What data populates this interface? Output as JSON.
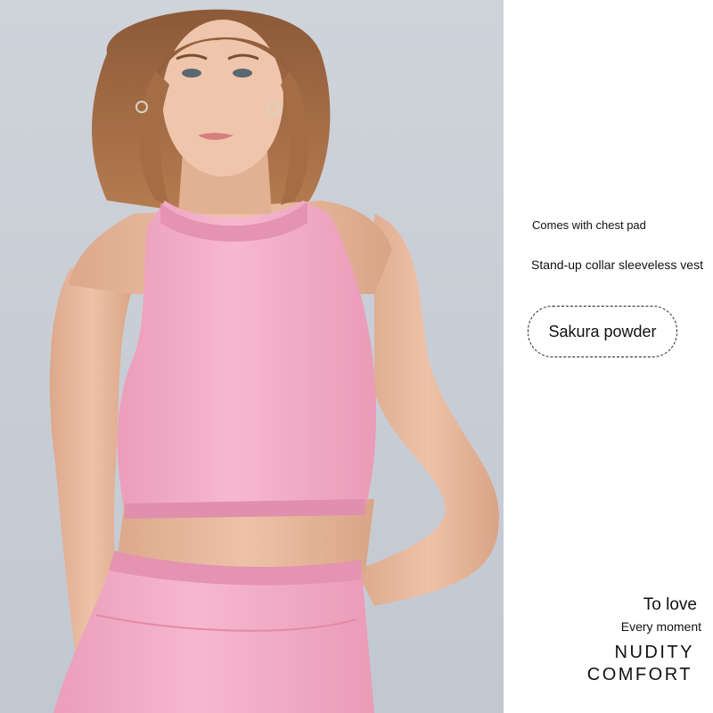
{
  "photo": {
    "subject": "woman-in-pink-crop-top",
    "colors": {
      "background": "#c9ced6",
      "garment": "#f2aac4",
      "skin": "#e8b89c",
      "hair": "#a06a45"
    }
  },
  "features": {
    "chest_pad": "Comes with chest pad",
    "collar": "Stand-up collar sleeveless vest"
  },
  "color_badge": {
    "label": "Sakura powder"
  },
  "slogan": {
    "line1": "To love",
    "line2": "Every moment",
    "line3": "NUDITY",
    "line4": "COMFORT"
  }
}
